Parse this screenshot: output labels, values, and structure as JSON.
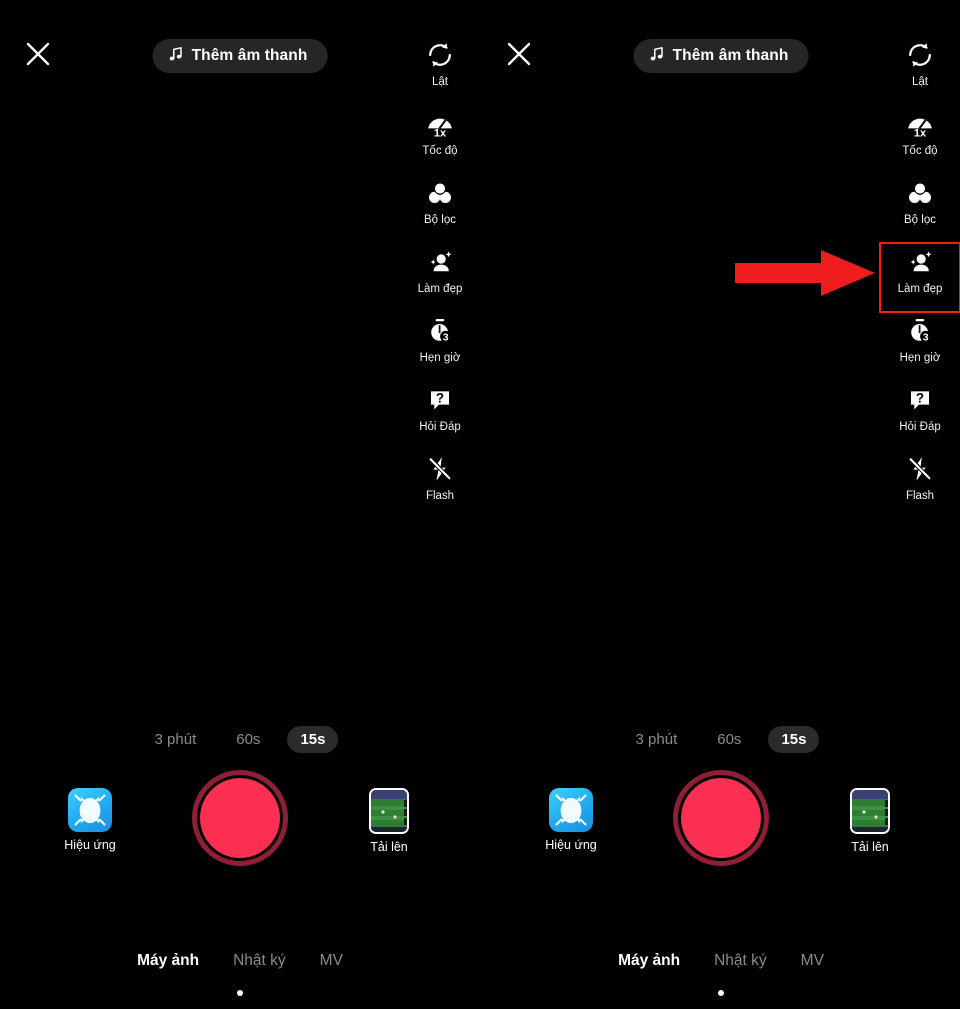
{
  "app": {
    "screen_title": "TikTok camera recording screen",
    "background_color": "#000000",
    "accent_red": "#fa2f51",
    "highlight_red": "#ff1a1a",
    "arrow_red": "#ef1d1d"
  },
  "topbar": {
    "close_icon": "close-x-icon",
    "sound_button": {
      "label": "Thêm âm thanh",
      "icon": "music-note-icon"
    }
  },
  "tools": [
    {
      "id": "flip",
      "label": "Lật",
      "icon": "flip-camera-icon"
    },
    {
      "id": "speed",
      "label": "Tốc độ",
      "icon": "speedometer-icon",
      "value": "1x"
    },
    {
      "id": "filter",
      "label": "Bộ lọc",
      "icon": "filter-circles-icon"
    },
    {
      "id": "beauty",
      "label": "Làm đẹp",
      "icon": "beautify-person-sparkle-icon"
    },
    {
      "id": "timer",
      "label": "Hẹn giờ",
      "icon": "stopwatch-icon",
      "value": "3"
    },
    {
      "id": "qa",
      "label": "Hỏi Đáp",
      "icon": "question-bubble-icon",
      "value": "?"
    },
    {
      "id": "flash",
      "label": "Flash",
      "icon": "flash-off-icon"
    }
  ],
  "annotation": {
    "arrow_icon": "right-arrow-annotation",
    "highlighted_tool_id": "beauty",
    "highlight_box_icon": "red-highlight-box"
  },
  "durations": {
    "options": [
      {
        "label": "3 phút",
        "active": false
      },
      {
        "label": "60s",
        "active": false
      },
      {
        "label": "15s",
        "active": true
      }
    ]
  },
  "controls": {
    "effects": {
      "label": "Hiệu ứng",
      "icon": "effects-face-icon"
    },
    "record": {
      "label": "",
      "icon": "record-button"
    },
    "upload": {
      "label": "Tải lên",
      "icon": "upload-thumbnail-icon"
    }
  },
  "tabs": [
    {
      "label": "Máy ảnh",
      "active": true
    },
    {
      "label": "Nhật ký",
      "active": false
    },
    {
      "label": "MV",
      "active": false
    }
  ]
}
